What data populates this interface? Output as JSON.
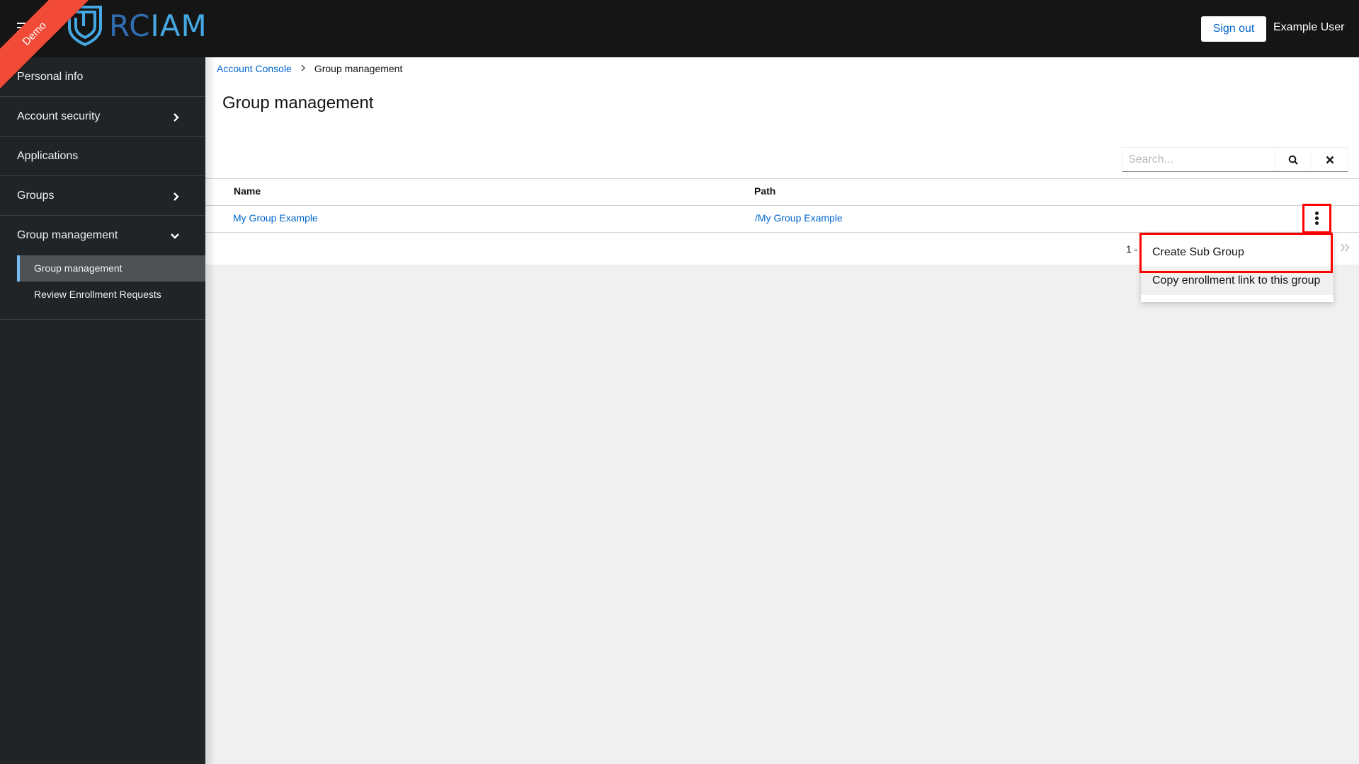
{
  "header": {
    "ribbon_label": "Demo",
    "logo_text_part1": "RC",
    "logo_text_part2": "IAM",
    "signout_label": "Sign out",
    "username": "Example User",
    "colors": {
      "logo_dark": "#2f6db3",
      "logo_light": "#46a8e2",
      "ribbon": "#f14a36"
    }
  },
  "sidebar": {
    "items": [
      {
        "label": "Personal info",
        "chevron": "none"
      },
      {
        "label": "Account security",
        "chevron": "right"
      },
      {
        "label": "Applications",
        "chevron": "none"
      },
      {
        "label": "Groups",
        "chevron": "right"
      },
      {
        "label": "Group management",
        "chevron": "down",
        "children": [
          {
            "label": "Group management",
            "active": true
          },
          {
            "label": "Review Enrollment Requests",
            "active": false
          }
        ]
      }
    ]
  },
  "breadcrumb": {
    "root": "Account Console",
    "current": "Group management"
  },
  "page": {
    "title": "Group management"
  },
  "search": {
    "placeholder": "Search...",
    "value": ""
  },
  "table": {
    "columns": [
      "Name",
      "Path"
    ],
    "rows": [
      {
        "name": "My Group Example",
        "path": "/My Group Example"
      }
    ]
  },
  "pagination": {
    "range_text": "1 -"
  },
  "row_actions_menu": {
    "items": [
      {
        "label": "Create Sub Group",
        "highlighted": true
      },
      {
        "label": "Copy enrollment link to this group",
        "hovered": true
      }
    ]
  },
  "accent_colors": {
    "link": "#0066cc",
    "active_border": "#73bcf7",
    "annotation": "#ff0000"
  }
}
